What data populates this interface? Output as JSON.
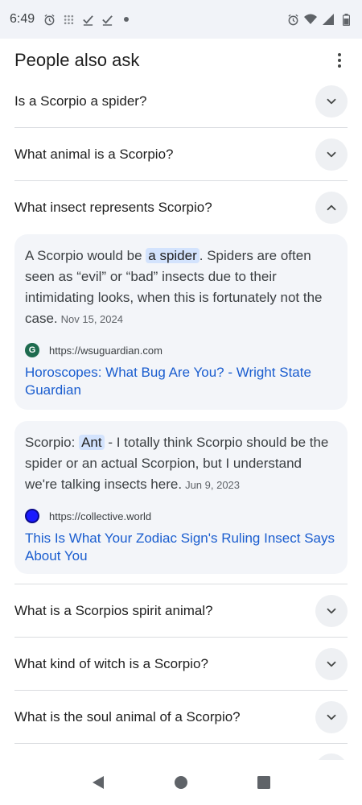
{
  "status_bar": {
    "time": "6:49",
    "left_icons": [
      "alarm-icon",
      "grid-dots-icon",
      "check-icon",
      "check-icon",
      "dot-icon"
    ],
    "right_icons": [
      "alarm-icon",
      "wifi-icon",
      "signal-icon",
      "battery-icon"
    ]
  },
  "section": {
    "title": "People also ask"
  },
  "questions": [
    {
      "text": "Is a Scorpio a spider?",
      "expanded": false
    },
    {
      "text": "What animal is a Scorpio?",
      "expanded": false
    },
    {
      "text": "What insect represents Scorpio?",
      "expanded": true
    },
    {
      "text": "What is a Scorpios spirit animal?",
      "expanded": false
    },
    {
      "text": "What kind of witch is a Scorpio?",
      "expanded": false
    },
    {
      "text": "What is the soul animal of a Scorpio?",
      "expanded": false
    }
  ],
  "answers": [
    {
      "before": "A Scorpio would be ",
      "highlight": "a spider",
      "after": ". Spiders are often seen as “evil” or “bad” insects due to their intimidating looks, when this is fortunately not the case.",
      "date": "Nov 15, 2024",
      "source_url": "https://wsuguardian.com",
      "source_favicon": "G",
      "link_text": "Horoscopes: What Bug Are You? - Wright State Guardian"
    },
    {
      "before": "Scorpio: ",
      "highlight": "Ant",
      "after": " - I totally think Scorpio should be the spider or an actual Scorpion, but I understand we're talking insects here.",
      "date": "Jun 9, 2023",
      "source_url": "https://collective.world",
      "source_favicon": "",
      "link_text": "This Is What Your Zodiac Sign's Ruling Insect Says About You"
    }
  ],
  "colors": {
    "link": "#1a5dcf",
    "highlight": "#d3e3fd",
    "card_bg": "#f3f5f9"
  }
}
